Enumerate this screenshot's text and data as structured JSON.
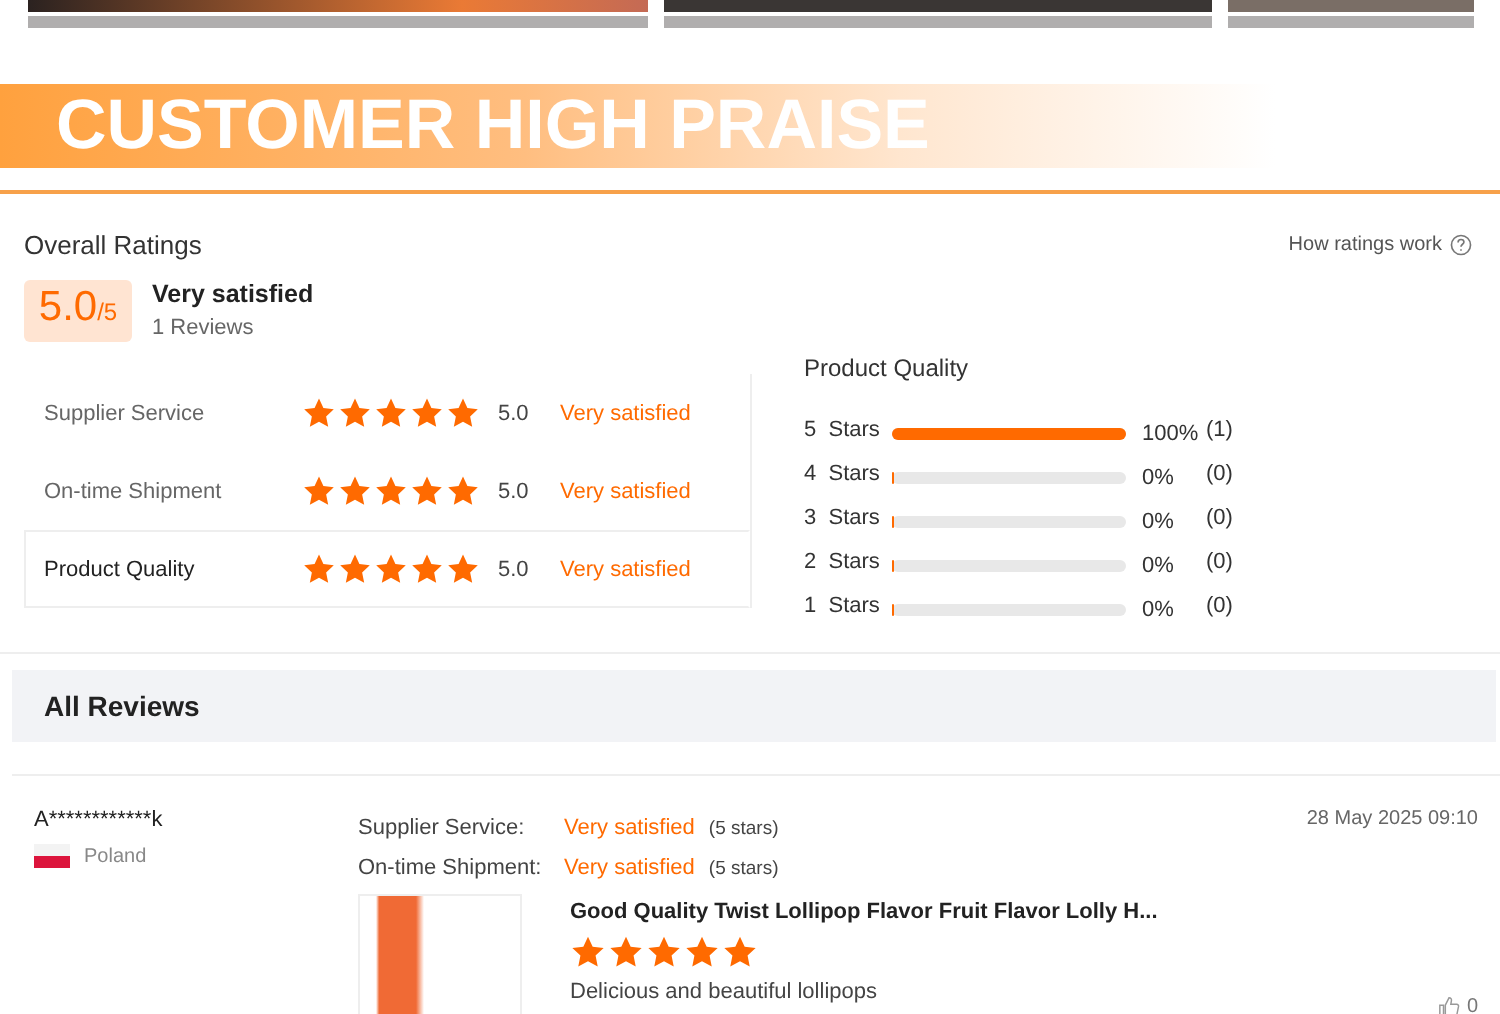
{
  "banner": {
    "title": "CUSTOMER HIGH PRAISE"
  },
  "ratings": {
    "heading": "Overall Ratings",
    "help_link": "How ratings work",
    "score": "5.0",
    "score_max": "/5",
    "verdict": "Very satisfied",
    "review_count": "1 Reviews",
    "aspects": [
      {
        "label": "Supplier Service",
        "stars": 5,
        "score": "5.0",
        "verdict": "Very satisfied",
        "selected": false
      },
      {
        "label": "On-time Shipment",
        "stars": 5,
        "score": "5.0",
        "verdict": "Very satisfied",
        "selected": false
      },
      {
        "label": "Product Quality",
        "stars": 5,
        "score": "5.0",
        "verdict": "Very satisfied",
        "selected": true
      }
    ],
    "breakdown_title": "Product Quality",
    "breakdown": [
      {
        "label": "5  Stars",
        "level": 1,
        "percent": "100%",
        "count": "(1)"
      },
      {
        "label": "4  Stars",
        "level": 0,
        "percent": "0%",
        "count": "(0)"
      },
      {
        "label": "3  Stars",
        "level": 0,
        "percent": "0%",
        "count": "(0)"
      },
      {
        "label": "2  Stars",
        "level": 0,
        "percent": "0%",
        "count": "(0)"
      },
      {
        "label": "1  Stars",
        "level": 0,
        "percent": "0%",
        "count": "(0)"
      }
    ]
  },
  "reviews_header": "All Reviews",
  "review": {
    "name": "A************k",
    "country": "Poland",
    "date": "28 May 2025 09:10",
    "aspects": [
      {
        "label": "Supplier Service:",
        "verdict": "Very satisfied",
        "stars_text": "(5 stars)"
      },
      {
        "label": "On-time Shipment:",
        "verdict": "Very satisfied",
        "stars_text": "(5 stars)"
      }
    ],
    "product_title": "Good Quality Twist Lollipop Flavor Fruit Flavor Lolly H...",
    "stars": 5,
    "text": "Delicious and beautiful lollipops",
    "likes": "0"
  }
}
